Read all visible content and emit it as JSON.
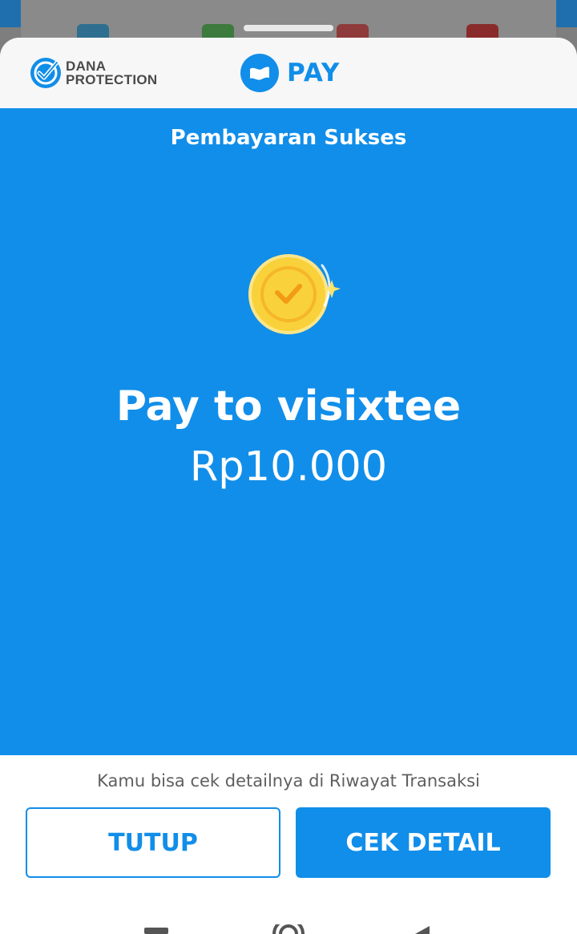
{
  "header": {
    "protection_line1": "DANA",
    "protection_line2": "PROTECTION",
    "pay_label": "PAY"
  },
  "status": {
    "title": "Pembayaran Sukses",
    "payee": "Pay to visixtee",
    "amount": "Rp10.000"
  },
  "footer": {
    "note": "Kamu bisa cek detailnya di Riwayat Transaksi",
    "close_label": "TUTUP",
    "detail_label": "CEK DETAIL"
  },
  "colors": {
    "primary": "#118ee9",
    "coin": "#f9d13b",
    "coin_inner": "#f4a41c"
  },
  "icons": [
    "dana-protection-icon",
    "dana-pay-logo",
    "success-coin-check-icon",
    "nav-recents-icon",
    "nav-home-icon",
    "nav-back-icon"
  ]
}
